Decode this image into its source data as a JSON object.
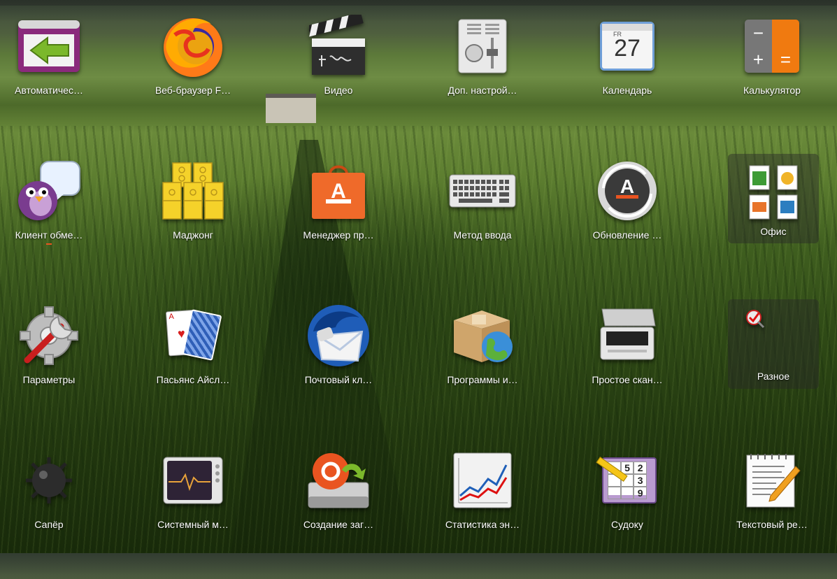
{
  "apps": [
    {
      "label": "Автоматичес…",
      "icon": "logout-arrow-icon"
    },
    {
      "label": "Веб-браузер F…",
      "icon": "firefox-icon"
    },
    {
      "label": "Видео",
      "icon": "clapperboard-icon"
    },
    {
      "label": "Доп. настрой…",
      "icon": "tweaks-panel-icon"
    },
    {
      "label": "Календарь",
      "icon": "calendar-icon",
      "day_abbr": "FR",
      "day": "27"
    },
    {
      "label": "Калькулятор",
      "icon": "calculator-icon",
      "minus": "−",
      "plus": "+",
      "equals": "="
    },
    {
      "label": "Клиент обме…",
      "icon": "pidgin-bird-icon"
    },
    {
      "label": "Маджонг",
      "icon": "mahjong-tiles-icon"
    },
    {
      "label": "Менеджер пр…",
      "icon": "software-store-bag-icon",
      "letter": "A"
    },
    {
      "label": "Метод ввода",
      "icon": "keyboard-icon"
    },
    {
      "label": "Обновление …",
      "icon": "software-updater-icon",
      "letter": "A"
    },
    {
      "label": "Офис",
      "icon": "office-folder-icon",
      "folder": true
    },
    {
      "label": "Параметры",
      "icon": "settings-wrench-gear-icon"
    },
    {
      "label": "Пасьянс Айсл…",
      "icon": "playing-cards-icon",
      "card_rank": "A",
      "card_suit": "♥"
    },
    {
      "label": "Почтовый кл…",
      "icon": "thunderbird-icon"
    },
    {
      "label": "Программы и…",
      "icon": "package-globe-icon"
    },
    {
      "label": "Простое скан…",
      "icon": "scanner-icon"
    },
    {
      "label": "Разное",
      "icon": "misc-folder-icon",
      "folder": true
    },
    {
      "label": "Сапёр",
      "icon": "mine-icon"
    },
    {
      "label": "Системный м…",
      "icon": "system-monitor-icon"
    },
    {
      "label": "Создание заг…",
      "icon": "startup-disk-icon"
    },
    {
      "label": "Статистика эн…",
      "icon": "power-statistics-icon"
    },
    {
      "label": "Судоку",
      "icon": "sudoku-icon",
      "digits": [
        "5",
        "2",
        "3",
        "9"
      ]
    },
    {
      "label": "Текстовый ре…",
      "icon": "text-editor-icon"
    }
  ],
  "colors": {
    "label": "#ffffff",
    "folder_bg": "#2828287a"
  }
}
